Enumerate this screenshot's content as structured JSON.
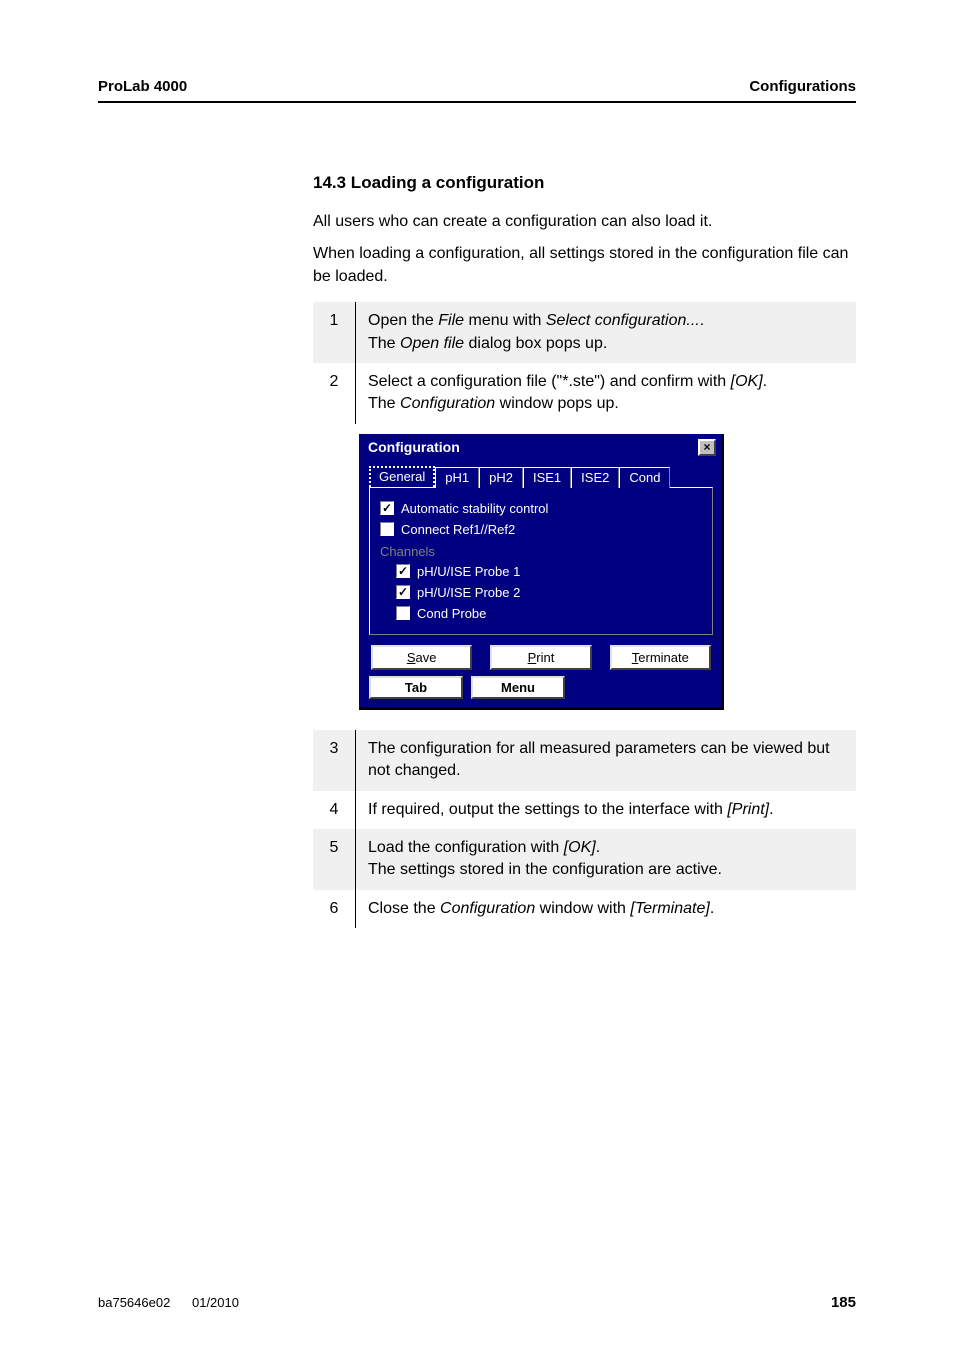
{
  "header": {
    "left": "ProLab 4000",
    "right": "Configurations"
  },
  "section_heading": "14.3    Loading a configuration",
  "intro": {
    "p1": "All users who can create a configuration can also load it.",
    "p2": "When loading a configuration, all settings stored in the configuration file can be loaded."
  },
  "steps_a": [
    {
      "num": "1",
      "parts": [
        {
          "t": "Open the ",
          "i": false
        },
        {
          "t": "File",
          "i": true
        },
        {
          "t": "  menu with ",
          "i": false
        },
        {
          "t": "Select configuration...",
          "i": true
        },
        {
          "t": ".",
          "i": false
        }
      ],
      "line2": [
        {
          "t": "The ",
          "i": false
        },
        {
          "t": "Open file",
          "i": true
        },
        {
          "t": " dialog box pops up.",
          "i": false
        }
      ]
    },
    {
      "num": "2",
      "parts": [
        {
          "t": "Select a configuration file (\"*.ste\") and confirm with ",
          "i": false
        },
        {
          "t": "[OK]",
          "i": true
        },
        {
          "t": ".",
          "i": false
        }
      ],
      "line2": [
        {
          "t": "The ",
          "i": false
        },
        {
          "t": "Configuration",
          "i": true
        },
        {
          "t": " window pops up.",
          "i": false
        }
      ]
    }
  ],
  "dialog": {
    "title": "Configuration",
    "close_glyph": "×",
    "tabs": [
      "General",
      "pH1",
      "pH2",
      "ISE1",
      "ISE2",
      "Cond"
    ],
    "active_tab": 0,
    "chk_auto": "Automatic stability control",
    "chk_connect": "Connect Ref1//Ref2",
    "group_channels": "Channels",
    "chk_probe1": "pH/U/ISE Probe 1",
    "chk_probe2": "pH/U/ISE Probe 2",
    "chk_cond": "Cond Probe",
    "btn_save": "Save",
    "btn_print": "Print",
    "btn_term": "Terminate",
    "btab_tab": "Tab",
    "btab_menu": "Menu"
  },
  "steps_b": [
    {
      "num": "3",
      "parts": [
        {
          "t": "The configuration for all measured parameters can be viewed but not changed.",
          "i": false
        }
      ]
    },
    {
      "num": "4",
      "parts": [
        {
          "t": "If required, output the settings to the interface with ",
          "i": false
        },
        {
          "t": "[Print]",
          "i": true
        },
        {
          "t": ".",
          "i": false
        }
      ]
    },
    {
      "num": "5",
      "parts": [
        {
          "t": "Load the configuration with ",
          "i": false
        },
        {
          "t": "[OK]",
          "i": true
        },
        {
          "t": ".",
          "i": false
        }
      ],
      "line2": [
        {
          "t": "The settings stored in the configuration are active.",
          "i": false
        }
      ]
    },
    {
      "num": "6",
      "parts": [
        {
          "t": "Close the ",
          "i": false
        },
        {
          "t": "Configuration",
          "i": true
        },
        {
          "t": " window with ",
          "i": false
        },
        {
          "t": "[Terminate]",
          "i": true
        },
        {
          "t": ".",
          "i": false
        }
      ]
    }
  ],
  "footer": {
    "doc": "ba75646e02",
    "date": "01/2010",
    "page": "185"
  }
}
